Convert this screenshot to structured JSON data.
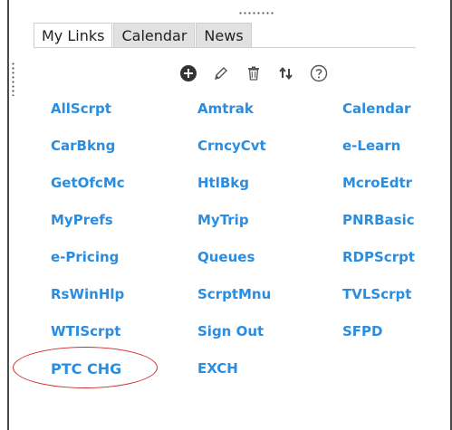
{
  "tabs": [
    {
      "label": "My Links",
      "active": true
    },
    {
      "label": "Calendar",
      "active": false
    },
    {
      "label": "News",
      "active": false
    }
  ],
  "toolbar": {
    "icons": [
      "add-icon",
      "edit-pencil-icon",
      "delete-trash-icon",
      "sort-arrows-icon",
      "help-icon"
    ]
  },
  "links": [
    [
      "AllScrpt",
      "Amtrak",
      "Calendar"
    ],
    [
      "CarBkng",
      "CrncyCvt",
      "e-Learn"
    ],
    [
      "GetOfcMc",
      "HtlBkg",
      "McroEdtr"
    ],
    [
      "MyPrefs",
      "MyTrip",
      "PNRBasic"
    ],
    [
      "e-Pricing",
      "Queues",
      "RDPScrpt"
    ],
    [
      "RsWinHlp",
      "ScrptMnu",
      "TVLScrpt"
    ],
    [
      "WTIScrpt",
      "Sign Out",
      "SFPD"
    ],
    [
      "PTC CHG",
      "EXCH"
    ]
  ],
  "colors": {
    "link": "#2a8de0",
    "annotation_circle": "#d02b2b",
    "tab_inactive_bg": "#e1e1e1"
  }
}
